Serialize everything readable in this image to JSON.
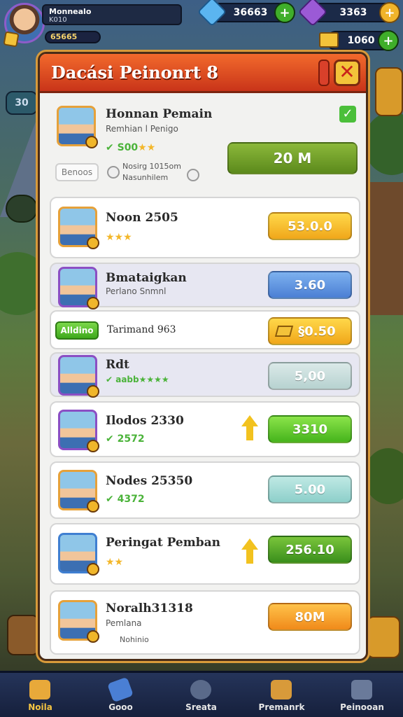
{
  "player": {
    "name": "Monnealo",
    "title": "K010",
    "xp_text": "65665"
  },
  "resources": [
    {
      "icon": "blue-gem-icon",
      "value": "36663",
      "color": "#5bb5f0"
    },
    {
      "icon": "purple-gem-icon",
      "value": "3363",
      "color": "#9b5ad6"
    },
    {
      "icon": "gold-bar-icon",
      "value": "1060",
      "color": "#f3c33a"
    }
  ],
  "side_badge": "30",
  "modal": {
    "title": "Dacási Peinonrt 8",
    "close_label": "✕"
  },
  "header_card": {
    "name": "Honnan Pemain",
    "sub": "Remhian l Penigo",
    "stars_prefix": "✔ S00",
    "stars": "★★",
    "tag": "Benoos",
    "desc_line1": "Nosirg 1015om",
    "desc_line2": "Nasunhilem",
    "button": "20 M"
  },
  "rows": [
    {
      "name": "Noon 2505",
      "sub": "",
      "stars": "★★★",
      "value": "53.0.0",
      "style": "yellow"
    },
    {
      "name": "Bmataigkan",
      "sub": "Perlano Snmnl",
      "stars": "",
      "value": "3.60",
      "style": "blue"
    },
    {
      "name": "Tarimand 963",
      "sub": "",
      "tag": "Alldino",
      "value": "§0.50",
      "style": "yellow"
    },
    {
      "name": "Rdt",
      "sub": "",
      "stars": "✔ aabb★★★★",
      "value": "5,00",
      "style": "grey"
    },
    {
      "name": "Ilodos 2330",
      "sub": "",
      "stars": "✔ 2572",
      "value": "3310",
      "style": "green"
    },
    {
      "name": "Nodes 25350",
      "sub": "",
      "stars": "✔ 4372",
      "value": "5.00",
      "style": "teal"
    },
    {
      "name": "Peringat Pemban",
      "sub": "",
      "stars": "★★",
      "value": "256.10",
      "style": "dgreen"
    },
    {
      "name": "Noralh31318",
      "sub": "Pemlana",
      "desc": "Nohinio",
      "value": "80M",
      "style": "orange"
    }
  ],
  "nav": [
    {
      "label": "Noila",
      "icon": "star-chest-icon",
      "active": true
    },
    {
      "label": "Gooo",
      "icon": "shield-icon",
      "active": false
    },
    {
      "label": "Sreata",
      "icon": "gear-icon",
      "active": false
    },
    {
      "label": "Premanrk",
      "icon": "treasure-icon",
      "active": false
    },
    {
      "label": "Peinooan",
      "icon": "bag-icon",
      "active": false
    }
  ]
}
